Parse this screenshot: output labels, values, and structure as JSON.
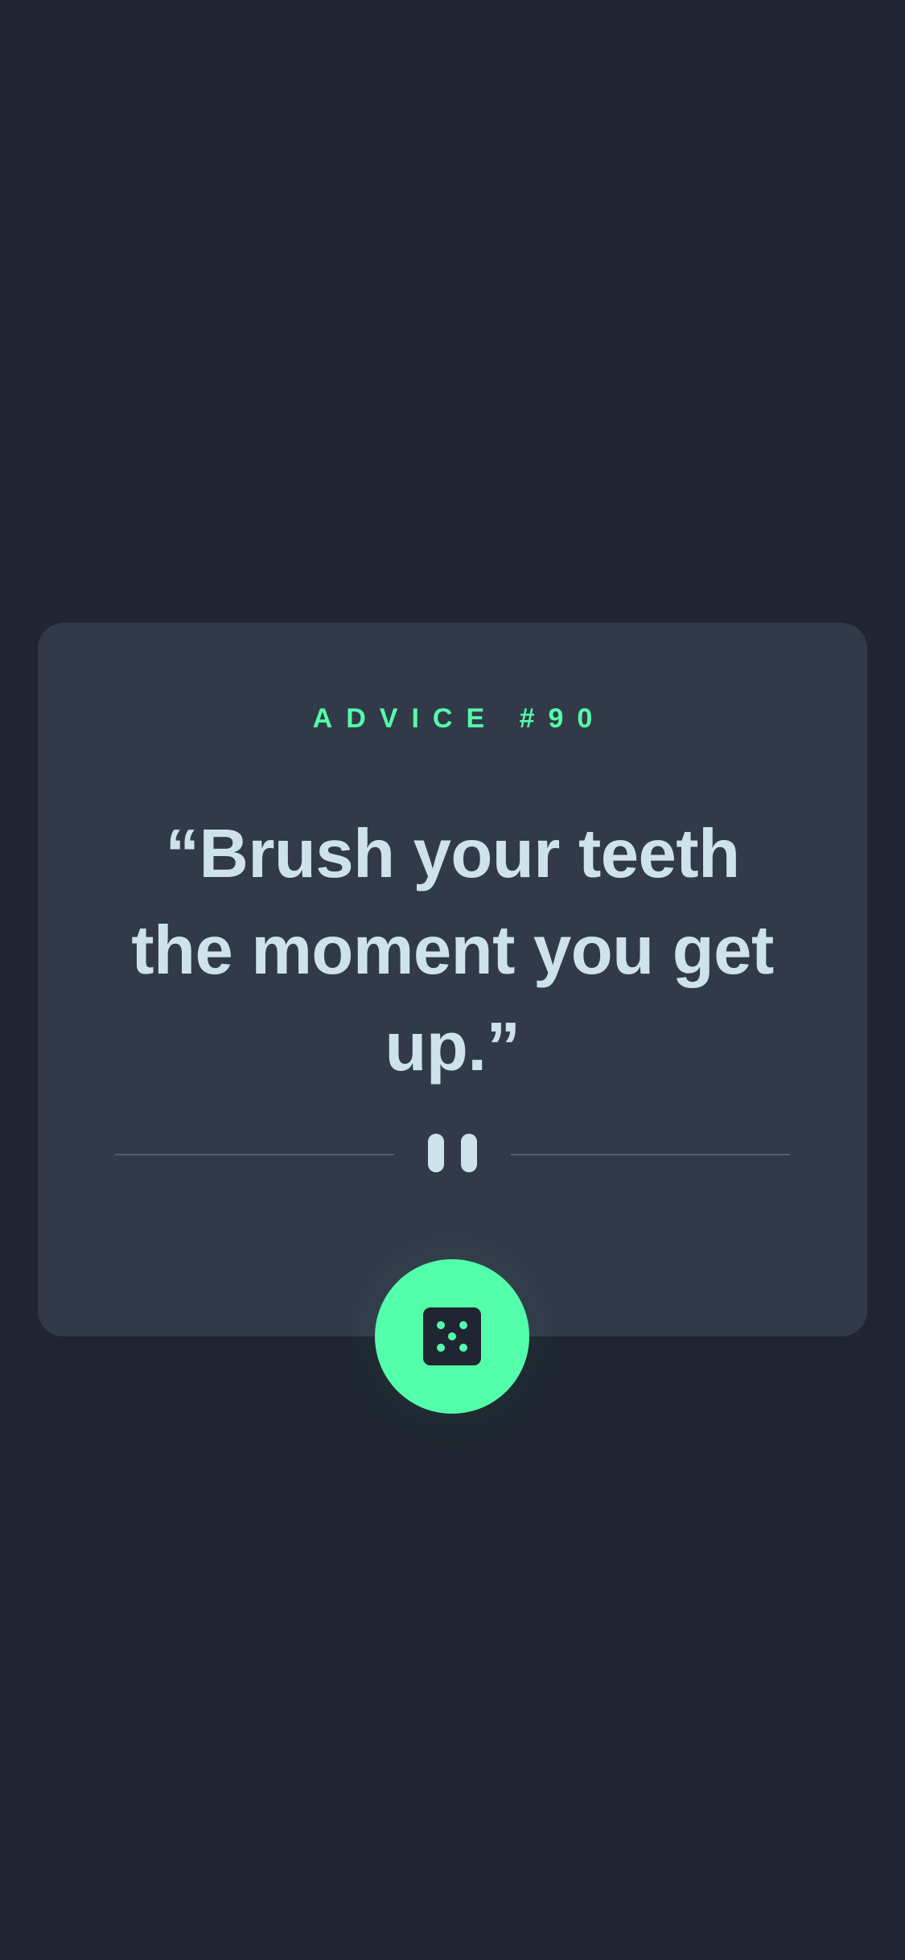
{
  "card": {
    "advice_label": "ADVICE #90",
    "advice_text": "“Brush your teeth the moment you get up.”"
  },
  "icons": {
    "divider": "pause-icon",
    "button": "dice-icon"
  },
  "colors": {
    "background": "#1f2631",
    "card": "#323a49",
    "accent": "#53ffaa",
    "text": "#cee3e9",
    "divider": "#4f5d74"
  }
}
